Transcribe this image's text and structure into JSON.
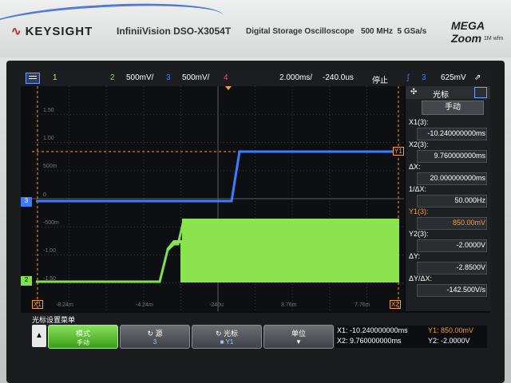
{
  "brand": {
    "name": "KEYSIGHT",
    "model": "InfiniiVision DSO-X3054T",
    "description": "Digital Storage Oscilloscope",
    "bandwidth": "500 MHz",
    "sample_rate": "5 GSa/s",
    "mega": "MEGA Zoom",
    "mega_sub": "1M wfm"
  },
  "topbar": {
    "ch1": "1",
    "ch2": "2",
    "ch2_scale": "500mV/",
    "ch3": "3",
    "ch3_scale": "500mV/",
    "ch4": "4",
    "timebase": "2.000ms/",
    "delay": "-240.0us",
    "run_state": "停止",
    "trig_ch": "3",
    "trig_level": "625mV",
    "colors": {
      "ch1": "#f2e14a",
      "ch2": "#7ee04a",
      "ch3": "#3c7dff",
      "ch4": "#ff4d5a"
    }
  },
  "graticule": {
    "y_labels": [
      "1.50",
      "1.00",
      "500m",
      "0",
      "-500m",
      "-1.00",
      "-1.50"
    ],
    "x_labels": [
      "-8.24m",
      "-4.24m",
      "-240u",
      "3.76m",
      "7.76m"
    ],
    "cursor_x1": "X1",
    "cursor_x2": "X2",
    "cursor_y1": "Y1",
    "ch2_marker": "2",
    "ch3_marker": "3"
  },
  "right_panel": {
    "title": "光标",
    "mode_btn": "手动",
    "x1_label": "X1(3):",
    "x1_value": "-10.240000000ms",
    "x2_label": "X2(3):",
    "x2_value": "9.760000000ms",
    "dx_label": "ΔX:",
    "dx_value": "20.000000000ms",
    "inv_dx_label": "1/ΔX:",
    "inv_dx_value": "50.000Hz",
    "y1_label": "Y1(3):",
    "y1_value": "850.00mV",
    "y2_label": "Y2(3):",
    "y2_value": "-2.0000V",
    "dy_label": "ΔY:",
    "dy_value": "-2.8500V",
    "dydx_label": "ΔY/ΔX:",
    "dydx_value": "-142.500V/s"
  },
  "softmenu": {
    "title": "光标设置菜单",
    "mode_label": "模式",
    "mode_value": "手动",
    "source_label": "源",
    "source_value": "3",
    "cursor_label": "光标",
    "cursor_value": "Y1",
    "unit_label": "单位",
    "readout": {
      "x1": "X1: -10.240000000ms",
      "y1": "Y1: 850.00mV",
      "x2": "X2: 9.760000000ms",
      "y2": "Y2: -2.0000V"
    }
  }
}
